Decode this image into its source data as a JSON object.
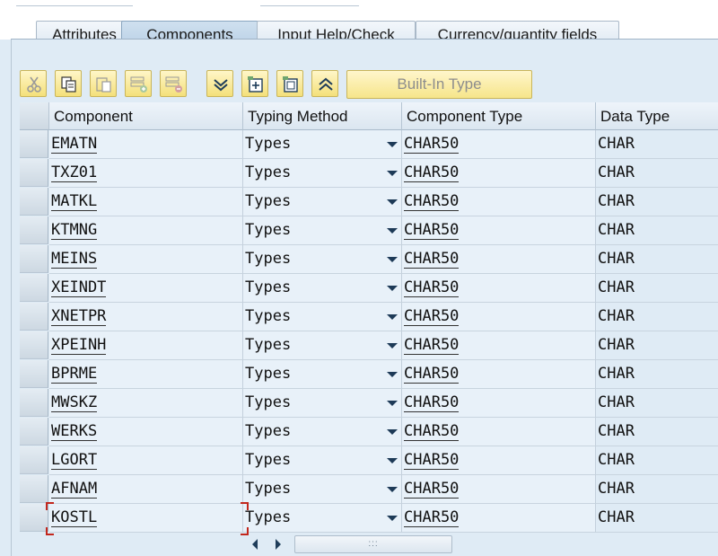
{
  "tabs": [
    {
      "label": "Attributes",
      "active": false
    },
    {
      "label": "Components",
      "active": true
    },
    {
      "label": "Input Help/Check",
      "active": false
    },
    {
      "label": "Currency/quantity fields",
      "active": false
    }
  ],
  "toolbar": {
    "icons": [
      "cut-icon",
      "copy-icon",
      "paste-icon",
      "insert-row-icon",
      "delete-row-icon",
      "move-down-icon",
      "insert-icon",
      "append-icon",
      "move-up-icon"
    ],
    "builtin_type_label": "Built-In Type"
  },
  "table": {
    "headers": [
      "Component",
      "Typing Method",
      "Component Type",
      "Data Type"
    ],
    "rows": [
      {
        "component": "EMATN",
        "typing": "Types",
        "ctype": "CHAR50",
        "dtype": "CHAR"
      },
      {
        "component": "TXZ01",
        "typing": "Types",
        "ctype": "CHAR50",
        "dtype": "CHAR"
      },
      {
        "component": "MATKL",
        "typing": "Types",
        "ctype": "CHAR50",
        "dtype": "CHAR"
      },
      {
        "component": "KTMNG",
        "typing": "Types",
        "ctype": "CHAR50",
        "dtype": "CHAR"
      },
      {
        "component": "MEINS",
        "typing": "Types",
        "ctype": "CHAR50",
        "dtype": "CHAR"
      },
      {
        "component": "XEINDT",
        "typing": "Types",
        "ctype": "CHAR50",
        "dtype": "CHAR"
      },
      {
        "component": "XNETPR",
        "typing": "Types",
        "ctype": "CHAR50",
        "dtype": "CHAR"
      },
      {
        "component": "XPEINH",
        "typing": "Types",
        "ctype": "CHAR50",
        "dtype": "CHAR"
      },
      {
        "component": "BPRME",
        "typing": "Types",
        "ctype": "CHAR50",
        "dtype": "CHAR"
      },
      {
        "component": "MWSKZ",
        "typing": "Types",
        "ctype": "CHAR50",
        "dtype": "CHAR"
      },
      {
        "component": "WERKS",
        "typing": "Types",
        "ctype": "CHAR50",
        "dtype": "CHAR"
      },
      {
        "component": "LGORT",
        "typing": "Types",
        "ctype": "CHAR50",
        "dtype": "CHAR"
      },
      {
        "component": "AFNAM",
        "typing": "Types",
        "ctype": "CHAR50",
        "dtype": "CHAR"
      },
      {
        "component": "KOSTL",
        "typing": "Types",
        "ctype": "CHAR50",
        "dtype": "CHAR"
      }
    ]
  },
  "scrollbar": {
    "thumb_grip": ":::"
  },
  "colors": {
    "accent": "#f4e07a",
    "focus": "#c2271d",
    "panel": "#dfebf5"
  }
}
